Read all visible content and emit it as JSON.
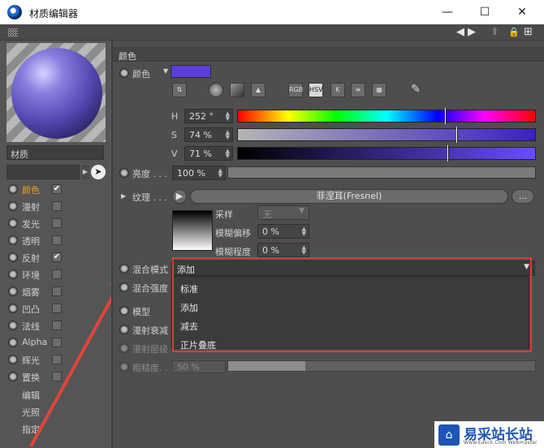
{
  "window": {
    "title": "材质编辑器",
    "minimize": "—",
    "maximize": "☐",
    "close": "✕"
  },
  "nav": {
    "left": "◀",
    "right": "▶",
    "up": "⬆",
    "lock": "🔒",
    "add": "⊞"
  },
  "material": {
    "name": "材质"
  },
  "channels": [
    {
      "label": "颜色",
      "checked": true,
      "active": true
    },
    {
      "label": "漫射",
      "checked": false
    },
    {
      "label": "发光",
      "checked": false
    },
    {
      "label": "透明",
      "checked": false
    },
    {
      "label": "反射",
      "checked": true
    },
    {
      "label": "环境",
      "checked": false
    },
    {
      "label": "烟雾",
      "checked": false
    },
    {
      "label": "凹凸",
      "checked": false
    },
    {
      "label": "法线",
      "checked": false
    },
    {
      "label": "Alpha",
      "checked": false
    },
    {
      "label": "辉光",
      "checked": false
    },
    {
      "label": "置换",
      "checked": false
    }
  ],
  "extra_items": [
    "编辑",
    "光照",
    "指定"
  ],
  "check_mark": "✔",
  "section": {
    "title": "颜色"
  },
  "color": {
    "label": "颜色",
    "swatch": "#5b3ed8",
    "tools": [
      "RGB",
      "HSV",
      "K",
      "≡",
      "▦"
    ],
    "h": {
      "label": "H",
      "value": "252 °",
      "fraction": 0.7
    },
    "s": {
      "label": "S",
      "value": "74 %",
      "fraction": 0.74
    },
    "v": {
      "label": "V",
      "value": "71 %",
      "fraction": 0.71
    }
  },
  "brightness": {
    "label": "亮度 . . .",
    "value": "100 %"
  },
  "texture": {
    "label": "纹理 . . .",
    "shader": "菲涅耳(Fresnel)",
    "more": "...",
    "sampling_label": "采样",
    "sampling_value": "无",
    "blur_offset_label": "模糊偏移",
    "blur_offset_value": "0 %",
    "blur_level_label": "模糊程度",
    "blur_level_value": "0 %"
  },
  "blend": {
    "mode_label": "混合模式",
    "mode_value": "添加",
    "strength_label": "混合强度",
    "options": [
      "标准",
      "添加",
      "减去",
      "正片叠底"
    ]
  },
  "model": {
    "label": "模型"
  },
  "diffuse_falloff": {
    "label": "漫射衰减"
  },
  "diffuse_level": {
    "label": "漫射层级"
  },
  "roughness": {
    "label": "粗糙度. . .",
    "value": "50 %"
  },
  "watermark": {
    "cn": "易采站长站",
    "en": "Www.Easck.Com Webmaster"
  }
}
